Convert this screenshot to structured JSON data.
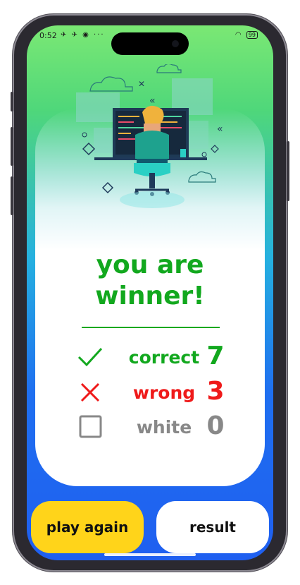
{
  "status_bar": {
    "time": "0:52",
    "battery": "99"
  },
  "result": {
    "title_line1": "you are",
    "title_line2": "winner!"
  },
  "stats": [
    {
      "label": "correct",
      "value": "7",
      "color": "#12a81e",
      "icon": "check-icon"
    },
    {
      "label": "wrong",
      "value": "3",
      "color": "#ef1a1a",
      "icon": "cross-icon"
    },
    {
      "label": "white",
      "value": "0",
      "color": "#888888",
      "icon": "empty-box-icon"
    }
  ],
  "buttons": {
    "play_again": "play again",
    "result": "result"
  },
  "colors": {
    "accent_green": "#12a81e",
    "wrong_red": "#ef1a1a",
    "play_yellow": "#ffd41a"
  }
}
